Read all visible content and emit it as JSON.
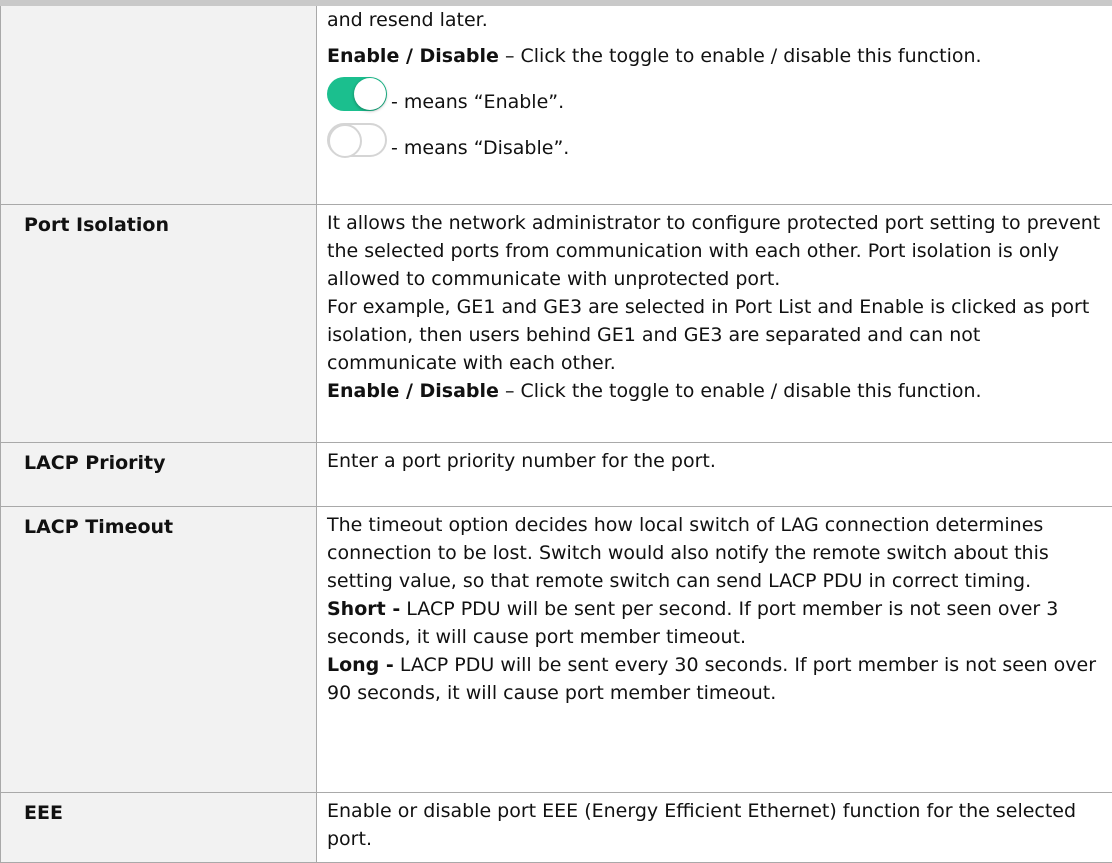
{
  "colors": {
    "toggle_on": "#1bbf8e",
    "toggle_off_border": "#d5d5d5",
    "label_bg": "#f2f2f2"
  },
  "rows": [
    {
      "label": "",
      "paras": [
        {
          "plain": "and resend later."
        },
        {
          "bold": "Enable / Disable",
          "rest": " – Click the toggle to enable / disable this function."
        }
      ],
      "toggles": [
        {
          "state": "on",
          "text": " - means “Enable”."
        },
        {
          "state": "off",
          "text": " - means “Disable”."
        }
      ]
    },
    {
      "label": "Port Isolation",
      "paras": [
        {
          "plain": "It allows the network administrator to configure protected port setting to prevent the selected ports from communication with each other. Port isolation is only allowed to communicate with unprotected port."
        },
        {
          "plain": "For example, GE1 and GE3 are selected in Port List and Enable is clicked as port isolation, then users behind GE1 and GE3 are separated and can not communicate with each other."
        },
        {
          "bold": "Enable / Disable",
          "rest": " – Click the toggle to enable / disable this function."
        }
      ]
    },
    {
      "label": "LACP Priority",
      "paras": [
        {
          "plain": "Enter a port priority number for the port."
        }
      ]
    },
    {
      "label": "LACP Timeout",
      "paras": [
        {
          "plain": "The timeout option decides how local switch of LAG connection determines connection to be lost. Switch would also notify the remote switch about this setting value, so that remote switch can send LACP PDU in correct timing."
        },
        {
          "bold": "Short -",
          "rest": " LACP PDU will be sent per second. If port member is not seen over 3 seconds, it will cause port member timeout."
        },
        {
          "bold": "Long -",
          "rest": " LACP PDU will be sent every 30 seconds. If port member is not seen over 90 seconds, it will cause port member timeout."
        }
      ]
    },
    {
      "label": "EEE",
      "paras": [
        {
          "plain": "Enable or disable port EEE (Energy Efficient Ethernet) function for the selected port."
        }
      ]
    }
  ]
}
